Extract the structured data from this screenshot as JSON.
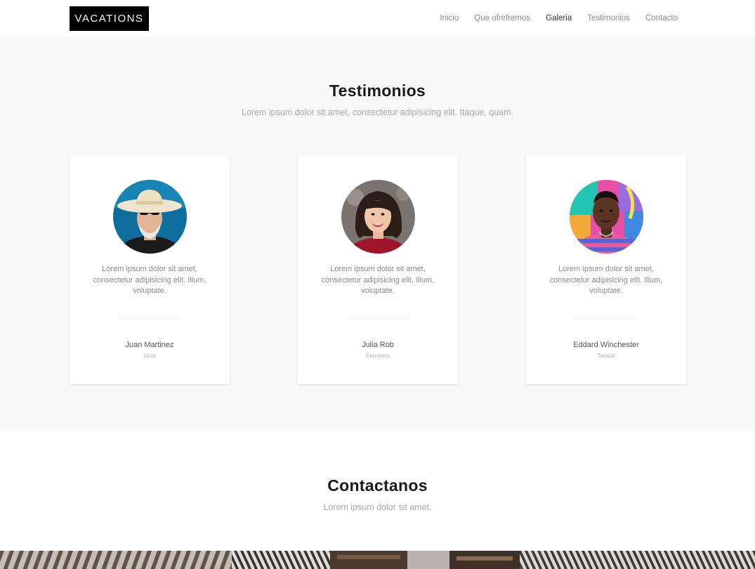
{
  "header": {
    "logo": "VACATIONS",
    "nav": [
      {
        "label": "Inicio"
      },
      {
        "label": "Que ofrefremos"
      },
      {
        "label": "Galeria"
      },
      {
        "label": "Testimonios"
      },
      {
        "label": "Contacto"
      }
    ],
    "active_nav": "Galeria"
  },
  "testimonials": {
    "title": "Testimonios",
    "subtitle": "Lorem ipsum dolor sit amet, consectetur adipisicing elit. Itaque, quam.",
    "cards": [
      {
        "quote": "Lorem ipsum dolor sit amet, consectetur adipisicing elit. Illum, voluptate.",
        "name": "Juan Martinez",
        "role": "Unix",
        "avatar": "man-cowboy-hat-photo"
      },
      {
        "quote": "Lorem ipsum dolor sit amet, consectetur adipisicing elit. Illum, voluptate.",
        "name": "Julia Rob",
        "role": "Ferreters",
        "avatar": "woman-smiling-photo"
      },
      {
        "quote": "Lorem ipsum dolor sit amet, consectetur adipisicing elit. Illum, voluptate.",
        "name": "Eddard Winchester",
        "role": "Tendai",
        "avatar": "man-colorful-wall-photo"
      }
    ]
  },
  "contact": {
    "title": "Contactanos",
    "subtitle": "Lorem ipsum dolor sit amet."
  },
  "colors": {
    "section_bg": "#f9f9f9",
    "logo_bg": "#000000",
    "heading": "#1a1a1a",
    "muted": "#a8a8a8"
  }
}
